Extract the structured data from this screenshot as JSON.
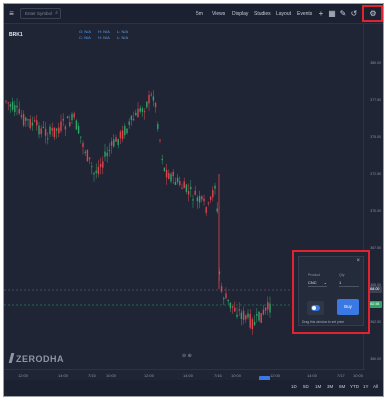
{
  "topbar": {
    "search_placeholder": "Enter Symbol",
    "menu": [
      "5m",
      "Views",
      "Display",
      "Studies",
      "Layout",
      "Events"
    ]
  },
  "symbol": "BRK1",
  "ohlc": [
    {
      "label": "O: N/A"
    },
    {
      "label": "H: N/A"
    },
    {
      "label": "L: N/A"
    },
    {
      "label": "C: N/A"
    },
    {
      "label": "H: N/A"
    },
    {
      "label": "L: N/A"
    }
  ],
  "y_axis": {
    "ticks": [
      "380.00",
      "377.50",
      "375.00",
      "372.50",
      "370.00",
      "367.50",
      "365.00",
      "362.50",
      "360.00"
    ]
  },
  "price_tags": [
    {
      "text": "364.00",
      "color": "#3a4254"
    },
    {
      "text": "362.58",
      "color": "#2fa56a"
    }
  ],
  "x_axis": {
    "ticks": [
      "12:00",
      "14:00",
      "7/15",
      "10:00",
      "12:00",
      "14:00",
      "7/16",
      "10:00",
      "12:00",
      "14:00",
      "7/17",
      "10:00"
    ]
  },
  "ranges": [
    "1D",
    "5D",
    "1M",
    "3M",
    "6M",
    "YTD",
    "1Y",
    "All"
  ],
  "watermark": "ZERODHA",
  "widget": {
    "product_label": "Product",
    "product_value": "CNC",
    "qty_label": "Qty",
    "qty_value": "1",
    "buy_label": "Buy",
    "drag_hint": "Drag this window to set price",
    "close": "×"
  },
  "colors": {
    "background": "#1f2535",
    "up": "#2fa56a",
    "down": "#e0454f",
    "highlight": "#e0232f",
    "accent": "#3a78e6"
  },
  "icons": [
    "search-icon",
    "plus-icon",
    "grid-icon",
    "pencil-icon",
    "undo-icon",
    "settings-icon"
  ]
}
